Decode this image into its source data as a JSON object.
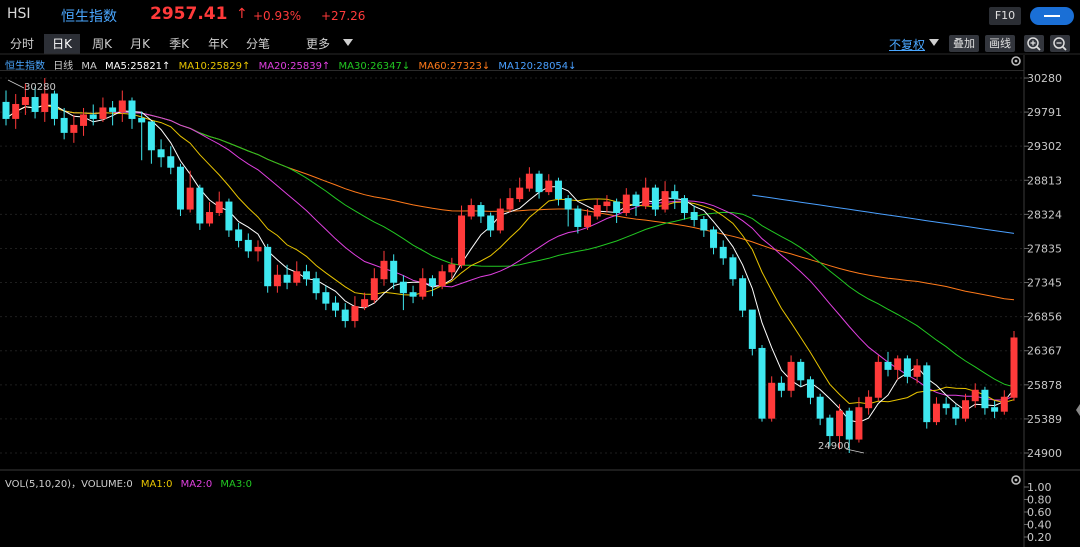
{
  "header": {
    "symbol": "HSI",
    "name": "恒生指数",
    "price": "2957.41",
    "arrow": "↑",
    "change_pct": "+0.93%",
    "change": "+27.26",
    "f10_label": "F10"
  },
  "tabs": [
    "分时",
    "日K",
    "周K",
    "月K",
    "季K",
    "年K",
    "分笔",
    "更多"
  ],
  "active_tab": "日K",
  "right_controls": {
    "adjust": "不复权",
    "overlay": "叠加",
    "draw": "画线"
  },
  "ma_legend": {
    "title": "恒生指数",
    "period": "日线",
    "ma": "MA",
    "ma5": "MA5:25821↑",
    "ma10": "MA10:25829↑",
    "ma20": "MA20:25839↑",
    "ma30": "MA30:26347↓",
    "ma60": "MA60:27323↓",
    "ma120": "MA120:28054↓"
  },
  "vol_legend": {
    "vol": "VOL(5,10,20)",
    "volume": "，VOLUME:0",
    "ma1": "MA1:0",
    "ma2": "MA2:0",
    "ma3": "MA3:0"
  },
  "colors": {
    "up": "#ff3a3a",
    "down": "#3fe8f0",
    "ma5": "#ffffff",
    "ma10": "#e8c400",
    "ma20": "#e040e0",
    "ma30": "#22c722",
    "ma60": "#ff7a1a",
    "ma120": "#4aa0ff"
  },
  "price_axis": [
    "30280",
    "29791",
    "29302",
    "28813",
    "28324",
    "27835",
    "27345",
    "26856",
    "26367",
    "25878",
    "25389",
    "24900"
  ],
  "volume_axis": [
    "1.00",
    "0.80",
    "0.60",
    "0.40",
    "0.20"
  ],
  "annotations": {
    "high": "30280",
    "low": "24900"
  },
  "chart_data": {
    "type": "candlestick",
    "ylim": [
      24900,
      30280
    ],
    "candles": [
      [
        29930,
        29700,
        30100,
        29600
      ],
      [
        29700,
        29900,
        30050,
        29550
      ],
      [
        29900,
        30000,
        30200,
        29750
      ],
      [
        30000,
        29800,
        30150,
        29700
      ],
      [
        29800,
        30050,
        30280,
        29650
      ],
      [
        30050,
        29700,
        30100,
        29600
      ],
      [
        29700,
        29500,
        29850,
        29400
      ],
      [
        29500,
        29600,
        29750,
        29350
      ],
      [
        29600,
        29750,
        29850,
        29450
      ],
      [
        29750,
        29700,
        29900,
        29600
      ],
      [
        29700,
        29850,
        30000,
        29650
      ],
      [
        29850,
        29800,
        29950,
        29600
      ],
      [
        29800,
        29950,
        30100,
        29650
      ],
      [
        29950,
        29700,
        30000,
        29550
      ],
      [
        29700,
        29650,
        29800,
        29100
      ],
      [
        29650,
        29250,
        29350,
        29050
      ],
      [
        29250,
        29150,
        29400,
        29000
      ],
      [
        29150,
        29000,
        29300,
        28900
      ],
      [
        29000,
        28400,
        29050,
        28300
      ],
      [
        28400,
        28700,
        28950,
        28350
      ],
      [
        28700,
        28200,
        28750,
        28100
      ],
      [
        28200,
        28350,
        28500,
        28150
      ],
      [
        28350,
        28500,
        28650,
        28300
      ],
      [
        28500,
        28100,
        28550,
        28000
      ],
      [
        28100,
        27950,
        28200,
        27850
      ],
      [
        27950,
        27800,
        28050,
        27700
      ],
      [
        27800,
        27850,
        27950,
        27650
      ],
      [
        27850,
        27300,
        27900,
        27200
      ],
      [
        27300,
        27450,
        27600,
        27200
      ],
      [
        27450,
        27350,
        27600,
        27250
      ],
      [
        27350,
        27500,
        27650,
        27300
      ],
      [
        27500,
        27400,
        27600,
        27300
      ],
      [
        27400,
        27200,
        27500,
        27100
      ],
      [
        27200,
        27050,
        27300,
        26950
      ],
      [
        27050,
        26950,
        27150,
        26850
      ],
      [
        26950,
        26800,
        27050,
        26700
      ],
      [
        26800,
        27000,
        27150,
        26700
      ],
      [
        27000,
        27100,
        27200,
        26950
      ],
      [
        27100,
        27400,
        27550,
        27050
      ],
      [
        27400,
        27650,
        27800,
        27300
      ],
      [
        27650,
        27350,
        27750,
        27250
      ],
      [
        27350,
        27200,
        27450,
        26950
      ],
      [
        27200,
        27150,
        27300,
        27050
      ],
      [
        27150,
        27400,
        27550,
        27100
      ],
      [
        27400,
        27300,
        27450,
        27150
      ],
      [
        27300,
        27500,
        27600,
        27250
      ],
      [
        27500,
        27600,
        27700,
        27400
      ],
      [
        27600,
        28300,
        28450,
        27550
      ],
      [
        28300,
        28450,
        28550,
        28250
      ],
      [
        28450,
        28300,
        28500,
        28200
      ],
      [
        28300,
        28100,
        28350,
        28000
      ],
      [
        28100,
        28400,
        28550,
        28050
      ],
      [
        28400,
        28550,
        28700,
        28350
      ],
      [
        28550,
        28700,
        28850,
        28500
      ],
      [
        28700,
        28900,
        29000,
        28650
      ],
      [
        28900,
        28650,
        28950,
        28550
      ],
      [
        28650,
        28800,
        28900,
        28600
      ],
      [
        28800,
        28550,
        28850,
        28450
      ],
      [
        28550,
        28400,
        28600,
        28150
      ],
      [
        28400,
        28150,
        28450,
        28050
      ],
      [
        28150,
        28300,
        28400,
        28100
      ],
      [
        28300,
        28450,
        28550,
        28250
      ],
      [
        28450,
        28500,
        28600,
        28350
      ],
      [
        28500,
        28350,
        28550,
        28200
      ],
      [
        28350,
        28600,
        28700,
        28300
      ],
      [
        28600,
        28450,
        28650,
        28300
      ],
      [
        28450,
        28700,
        28850,
        28400
      ],
      [
        28700,
        28400,
        28750,
        28300
      ],
      [
        28400,
        28650,
        28800,
        28350
      ],
      [
        28650,
        28550,
        28750,
        28400
      ],
      [
        28550,
        28350,
        28600,
        28250
      ],
      [
        28350,
        28250,
        28450,
        28150
      ],
      [
        28250,
        28100,
        28300,
        28000
      ],
      [
        28100,
        27850,
        28150,
        27750
      ],
      [
        27850,
        27700,
        27950,
        27600
      ],
      [
        27700,
        27400,
        27750,
        27300
      ],
      [
        27400,
        26950,
        27450,
        26850
      ],
      [
        26950,
        26400,
        26950,
        26300
      ],
      [
        26400,
        25400,
        26450,
        25350
      ],
      [
        25400,
        25900,
        26000,
        25350
      ],
      [
        25900,
        25800,
        26000,
        25700
      ],
      [
        25800,
        26200,
        26300,
        25700
      ],
      [
        26200,
        25950,
        26250,
        25850
      ],
      [
        25950,
        25700,
        26000,
        25600
      ],
      [
        25700,
        25400,
        25750,
        25300
      ],
      [
        25400,
        25150,
        25450,
        25000
      ],
      [
        25150,
        25500,
        25600,
        24950
      ],
      [
        25500,
        25100,
        25550,
        24900
      ],
      [
        25100,
        25550,
        25700,
        25050
      ],
      [
        25550,
        25700,
        25800,
        25450
      ],
      [
        25700,
        26200,
        26300,
        25650
      ],
      [
        26200,
        26100,
        26350,
        26000
      ],
      [
        26100,
        26250,
        26300,
        25950
      ],
      [
        26250,
        26000,
        26300,
        25900
      ],
      [
        26000,
        26150,
        26250,
        25900
      ],
      [
        26150,
        25350,
        26200,
        25250
      ],
      [
        25350,
        25600,
        25700,
        25300
      ],
      [
        25600,
        25550,
        25700,
        25450
      ],
      [
        25550,
        25400,
        25600,
        25300
      ],
      [
        25400,
        25650,
        25750,
        25350
      ],
      [
        25650,
        25800,
        25900,
        25550
      ],
      [
        25800,
        25550,
        25850,
        25450
      ],
      [
        25550,
        25500,
        25650,
        25400
      ],
      [
        25500,
        25700,
        25800,
        25450
      ],
      [
        25700,
        26550,
        26650,
        25650
      ]
    ]
  }
}
